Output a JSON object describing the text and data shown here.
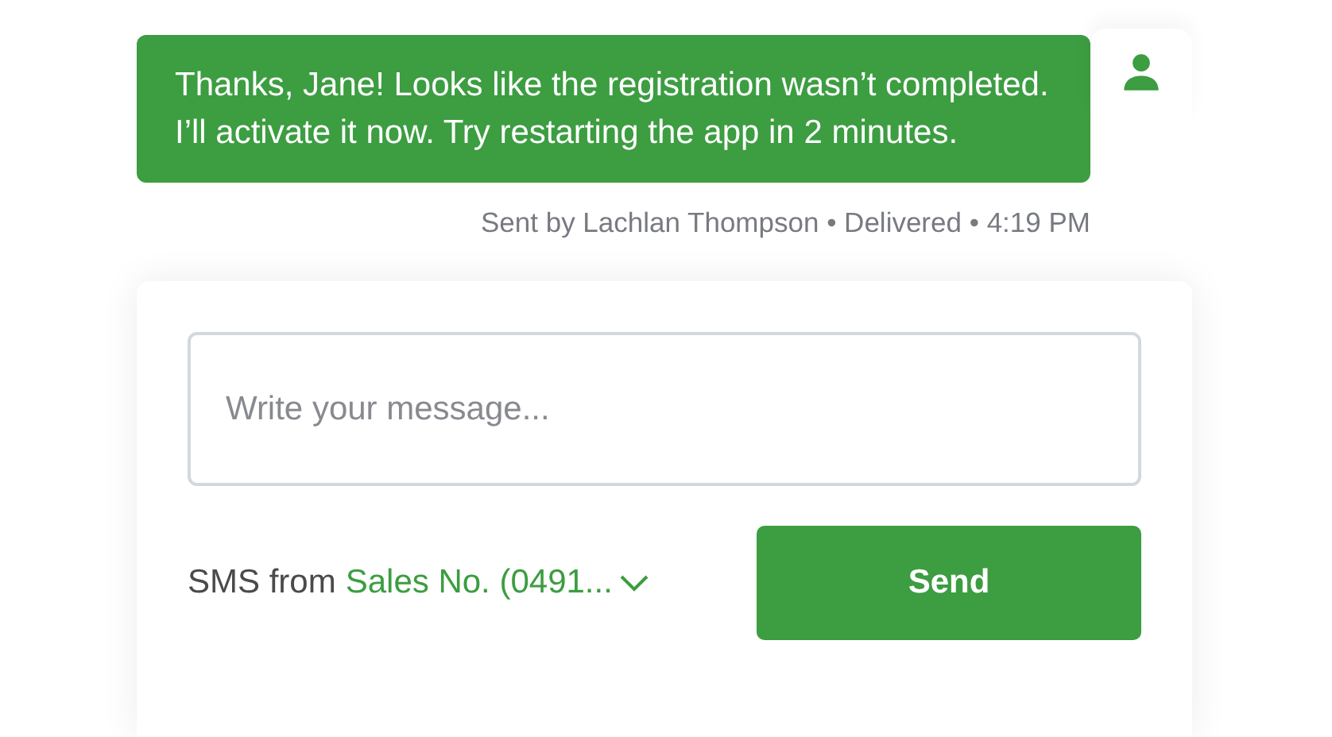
{
  "message": {
    "text": "Thanks, Jane! Looks like the registration wasn’t completed. I’ll activate it now. Try restarting the app in 2 minutes.",
    "meta": "Sent by Lachlan Thompson • Delivered • 4:19 PM"
  },
  "composer": {
    "placeholder": "Write your message...",
    "sender_label": "SMS from",
    "sender_value": "Sales No. (0491...",
    "send_button": "Send"
  }
}
